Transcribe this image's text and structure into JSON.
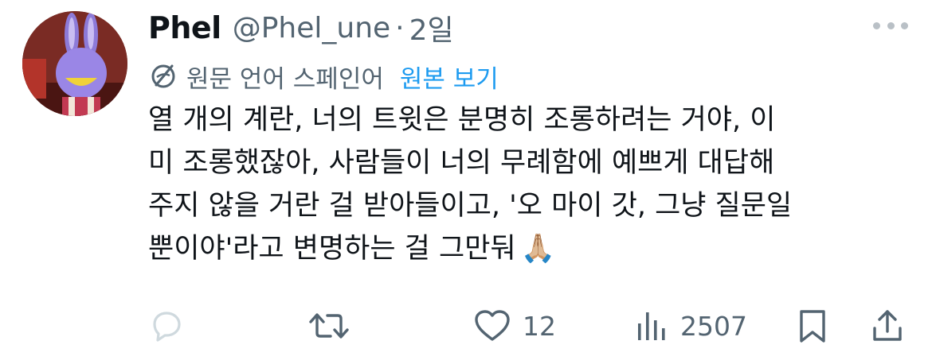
{
  "tweet": {
    "author_name": "Phel",
    "handle": "@Phel_une",
    "separator": "·",
    "time": "2일",
    "translation": {
      "label": "원문 언어 스페인어",
      "show_original": "원본 보기"
    },
    "lines": [
      "열 개의 계란, 너의 트윗은 분명히 조롱하려는 거야, 이",
      "미 조롱했잖아, 사람들이 너의 무례함에 예쁘게 대답해",
      "주지 않을 거란 걸 받아들이고, '오 마이 갓, 그냥 질문일",
      "뿐이야'라고 변명하는 걸 그만둬"
    ],
    "emoji": "🙏🏼"
  },
  "actions": {
    "likes": "12",
    "views": "2507"
  },
  "icons": {
    "avatar": "avatar-cartoon-character",
    "more": "more-horizontal-icon",
    "translate": "globe-translate-icon",
    "reply": "reply-icon",
    "retweet": "retweet-icon",
    "like": "heart-icon",
    "views": "views-bar-chart-icon",
    "bookmark": "bookmark-icon",
    "share": "share-icon"
  },
  "colors": {
    "text": "#0f1419",
    "muted": "#536471",
    "link": "#1d9bf0",
    "reply_faded": "#cfd9de"
  }
}
